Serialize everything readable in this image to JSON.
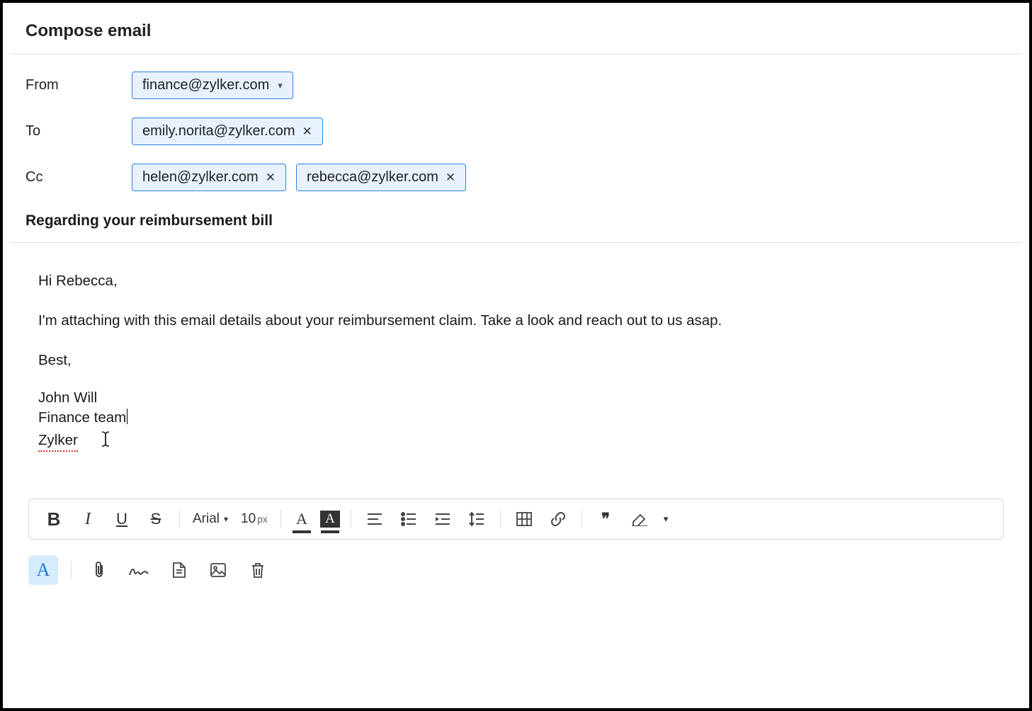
{
  "title": "Compose email",
  "labels": {
    "from": "From",
    "to": "To",
    "cc": "Cc"
  },
  "from": {
    "email": "finance@zylker.com"
  },
  "to": [
    {
      "email": "emily.norita@zylker.com"
    }
  ],
  "cc": [
    {
      "email": "helen@zylker.com"
    },
    {
      "email": "rebecca@zylker.com"
    }
  ],
  "subject": "Regarding your reimbursement bill",
  "body": {
    "greeting": "Hi Rebecca,",
    "p1": "I'm attaching with this email details about your reimbursement claim. Take a look and reach out to us asap.",
    "closing": "Best,",
    "sig_name": "John Will",
    "sig_team": "Finance team",
    "sig_company": "Zylker"
  },
  "toolbar": {
    "font": "Arial",
    "size_value": "10",
    "size_unit": "px"
  }
}
